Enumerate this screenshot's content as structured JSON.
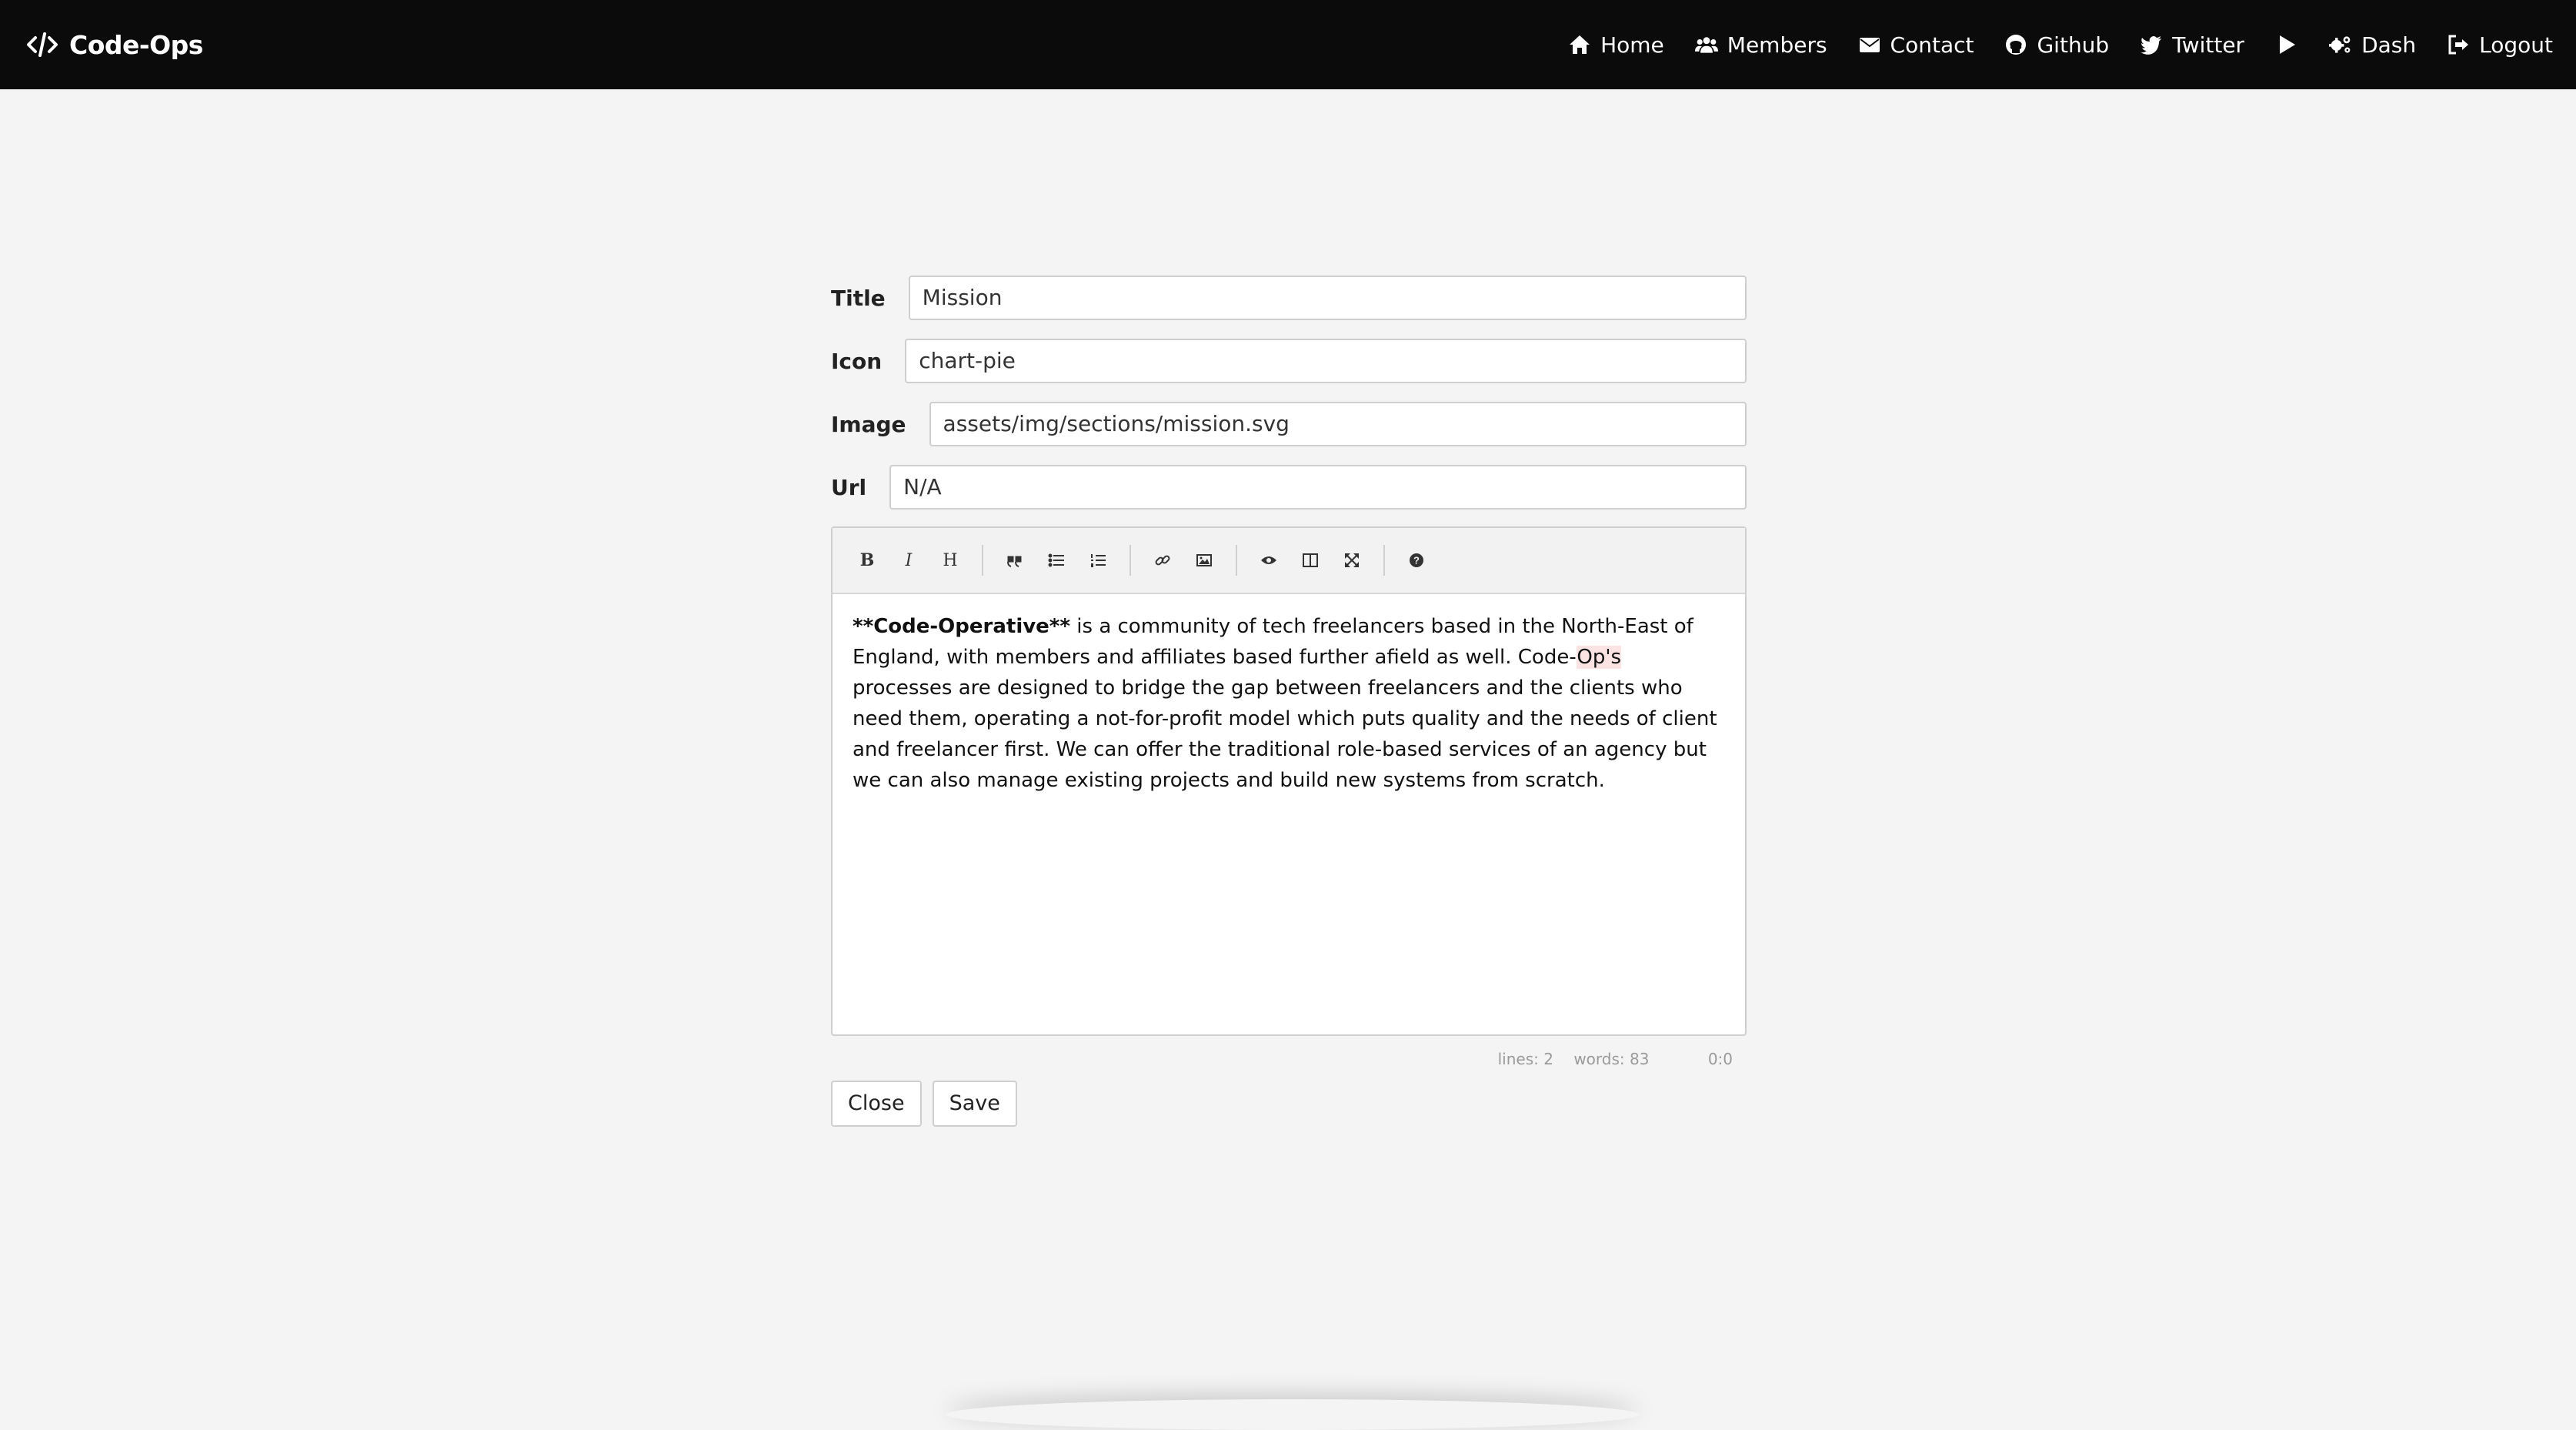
{
  "navbar": {
    "brand": "Code-Ops",
    "brand_icon": "code-icon",
    "items": [
      {
        "label": "Home",
        "icon": "home-icon"
      },
      {
        "label": "Members",
        "icon": "users-icon"
      },
      {
        "label": "Contact",
        "icon": "envelope-icon"
      },
      {
        "label": "Github",
        "icon": "github-icon"
      },
      {
        "label": "Twitter",
        "icon": "twitter-icon"
      },
      {
        "label": "",
        "icon": "play-icon"
      },
      {
        "label": "Dash",
        "icon": "cogs-icon"
      },
      {
        "label": "Logout",
        "icon": "sign-out-icon"
      }
    ]
  },
  "form": {
    "title_label": "Title",
    "title_value": "Mission",
    "icon_label": "Icon",
    "icon_value": "chart-pie",
    "image_label": "Image",
    "image_value": "assets/img/sections/mission.svg",
    "url_label": "Url",
    "url_value": "N/A"
  },
  "editor": {
    "toolbar": [
      "bold",
      "italic",
      "heading",
      "quote",
      "unordered-list",
      "ordered-list",
      "link",
      "image",
      "preview",
      "side-by-side",
      "fullscreen",
      "guide"
    ],
    "text_bold": "**Code-Operative**",
    "text_part1": " is a community of tech freelancers based in the North-East of England, with members and affiliates based further afield as well. Code-",
    "text_typo": "Op's",
    "text_part2": " processes are designed to bridge the gap between freelancers and the clients who need them, operating a not-for-profit model which puts quality and the needs of client and freelancer first. We can offer the traditional role-based services of an agency but we can also manage existing projects and build new systems from scratch."
  },
  "status": {
    "lines": "lines: 2",
    "words": "words: 83",
    "cursor": "0:0"
  },
  "buttons": {
    "close": "Close",
    "save": "Save"
  },
  "colors": {
    "navbar_bg": "#0b0b0b",
    "page_bg": "#f4f4f4",
    "spell_highlight": "#fbe3e3"
  }
}
